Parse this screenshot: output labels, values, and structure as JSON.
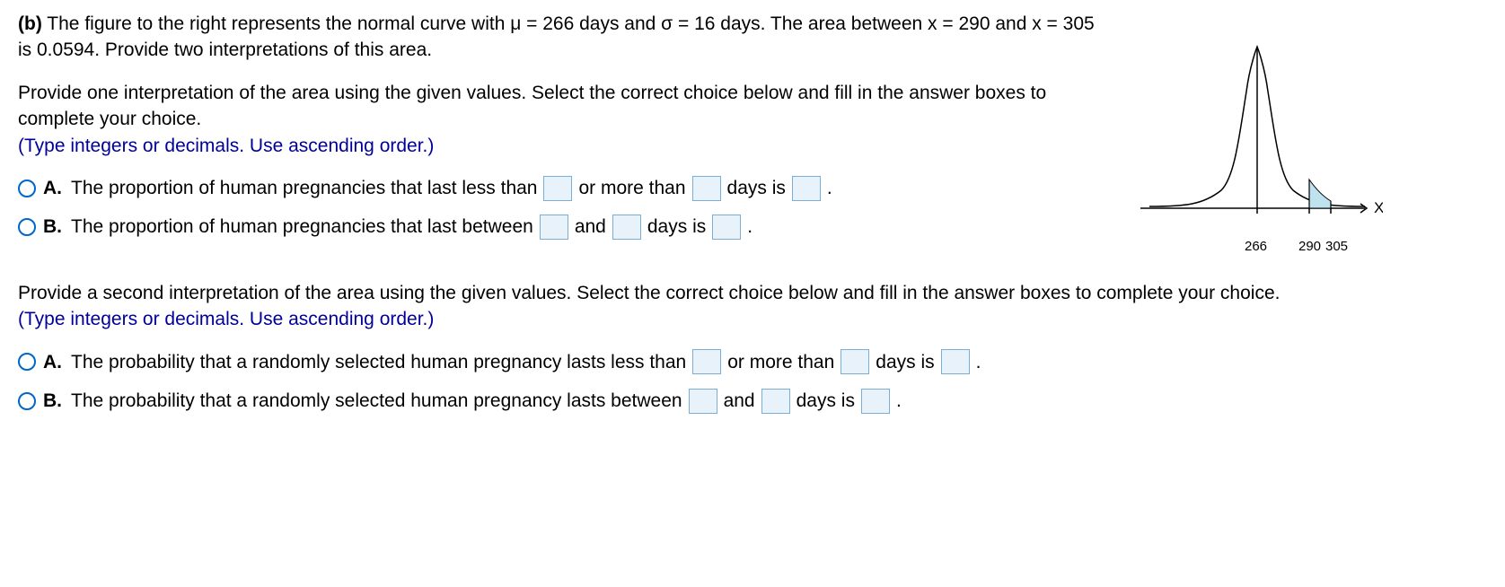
{
  "problem": {
    "part_label": "(b)",
    "intro": "The figure to the right represents the normal curve with μ = 266 days and σ = 16 days. The area between x = 290 and x = 305 is 0.0594. Provide two interpretations of this area."
  },
  "q1": {
    "prompt": "Provide one interpretation of the area using the given values. Select the correct choice below and fill in the answer boxes to complete your choice.",
    "hint": "(Type integers or decimals. Use ascending order.)",
    "optA": {
      "letter": "A.",
      "t1": "The proportion of human pregnancies that last less than",
      "t2": "or more than",
      "t3": "days is",
      "t4": "."
    },
    "optB": {
      "letter": "B.",
      "t1": "The proportion of human pregnancies that last between",
      "t2": "and",
      "t3": "days is",
      "t4": "."
    }
  },
  "q2": {
    "prompt": "Provide a second interpretation of the area using the given values. Select the correct choice below and fill in the answer boxes to complete your choice.",
    "hint": "(Type integers or decimals. Use ascending order.)",
    "optA": {
      "letter": "A.",
      "t1": "The probability that a randomly selected human pregnancy lasts less than",
      "t2": "or more than",
      "t3": "days is",
      "t4": "."
    },
    "optB": {
      "letter": "B.",
      "t1": "The probability that a randomly selected human pregnancy lasts between",
      "t2": "and",
      "t3": "days is",
      "t4": "."
    }
  },
  "chart_data": {
    "type": "line",
    "title": "",
    "xlabel": "X",
    "ylabel": "",
    "mean": 266,
    "sigma": 16,
    "shaded_region": {
      "from": 290,
      "to": 305,
      "area": 0.0594
    },
    "axis_ticks": [
      266,
      290,
      305
    ]
  }
}
